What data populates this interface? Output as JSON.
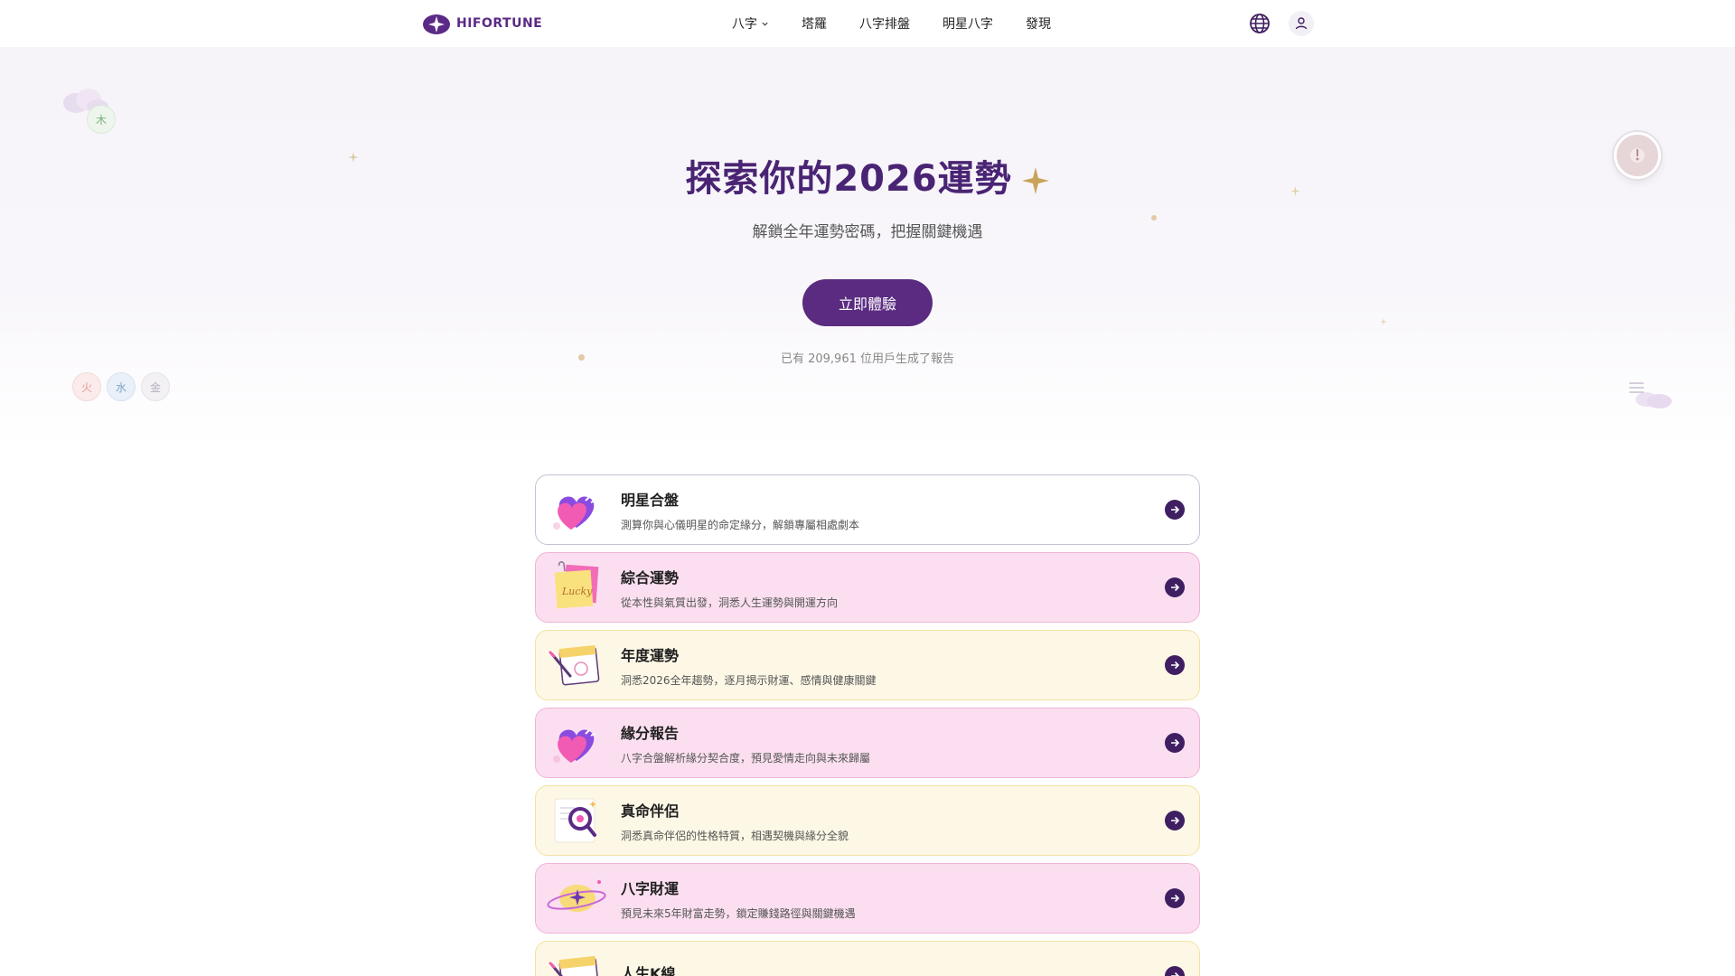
{
  "header": {
    "brand": "HIFORTUNE",
    "nav": [
      {
        "label": "八字",
        "has_dropdown": true
      },
      {
        "label": "塔羅"
      },
      {
        "label": "八字排盤"
      },
      {
        "label": "明星八字"
      },
      {
        "label": "發現"
      }
    ],
    "icons": [
      "globe-icon",
      "user-icon"
    ]
  },
  "hero": {
    "title": "探索你的2026運勢",
    "subtitle": "解鎖全年運勢密碼，把握關鍵機遇",
    "cta_label": "立即體驗",
    "users_text": "已有 209,961 位用戶生成了報告",
    "element_badges": [
      "木",
      "火",
      "水",
      "金"
    ]
  },
  "cards": [
    {
      "title": "明星合盤",
      "desc": "測算你與心儀明星的命定緣分，解鎖專屬相處劇本",
      "style": "white",
      "icon": "heart-icon"
    },
    {
      "title": "綜合運勢",
      "desc": "從本性與氣質出發，洞悉人生運勢與開運方向",
      "style": "pink",
      "icon": "lucky-note-icon"
    },
    {
      "title": "年度運勢",
      "desc": "洞悉2026全年趨勢，逐月揭示財運、感情與健康關鍵",
      "style": "cream",
      "icon": "calendar-icon"
    },
    {
      "title": "緣分報告",
      "desc": "八字合盤解析緣分契合度，預見愛情走向與未來歸屬",
      "style": "pink",
      "icon": "heart-icon"
    },
    {
      "title": "真命伴侶",
      "desc": "洞悉真命伴侶的性格特質，相遇契機與緣分全貌",
      "style": "cream",
      "icon": "magnifier-icon"
    },
    {
      "title": "八字財運",
      "desc": "預見未來5年財富走勢，鎖定賺錢路徑與關鍵機遇",
      "style": "pink",
      "icon": "planet-icon"
    },
    {
      "title": "人生K線",
      "desc": "",
      "style": "cream",
      "icon": "calendar-icon"
    }
  ],
  "colors": {
    "brand": "#5a2b80",
    "title": "#4a2474",
    "pink_card": "#fbdff0",
    "cream_card": "#fdf8e6"
  }
}
